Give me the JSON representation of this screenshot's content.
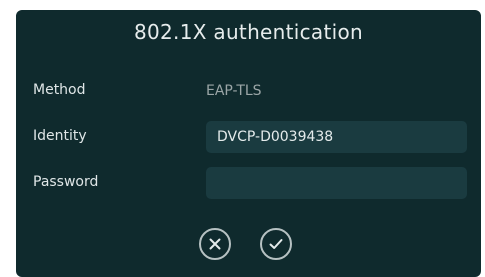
{
  "dialog": {
    "title": "802.1X authentication"
  },
  "fields": {
    "method": {
      "label": "Method",
      "value": "EAP-TLS"
    },
    "identity": {
      "label": "Identity",
      "value": "DVCP-D0039438"
    },
    "password": {
      "label": "Password",
      "value": ""
    }
  },
  "actions": {
    "cancel_icon": "close-icon",
    "confirm_icon": "check-icon"
  },
  "colors": {
    "panel_background": "#0f2a2d",
    "field_background": "#1a3b40",
    "text": "#dfe6e7",
    "muted_text": "#9ba6a7"
  }
}
